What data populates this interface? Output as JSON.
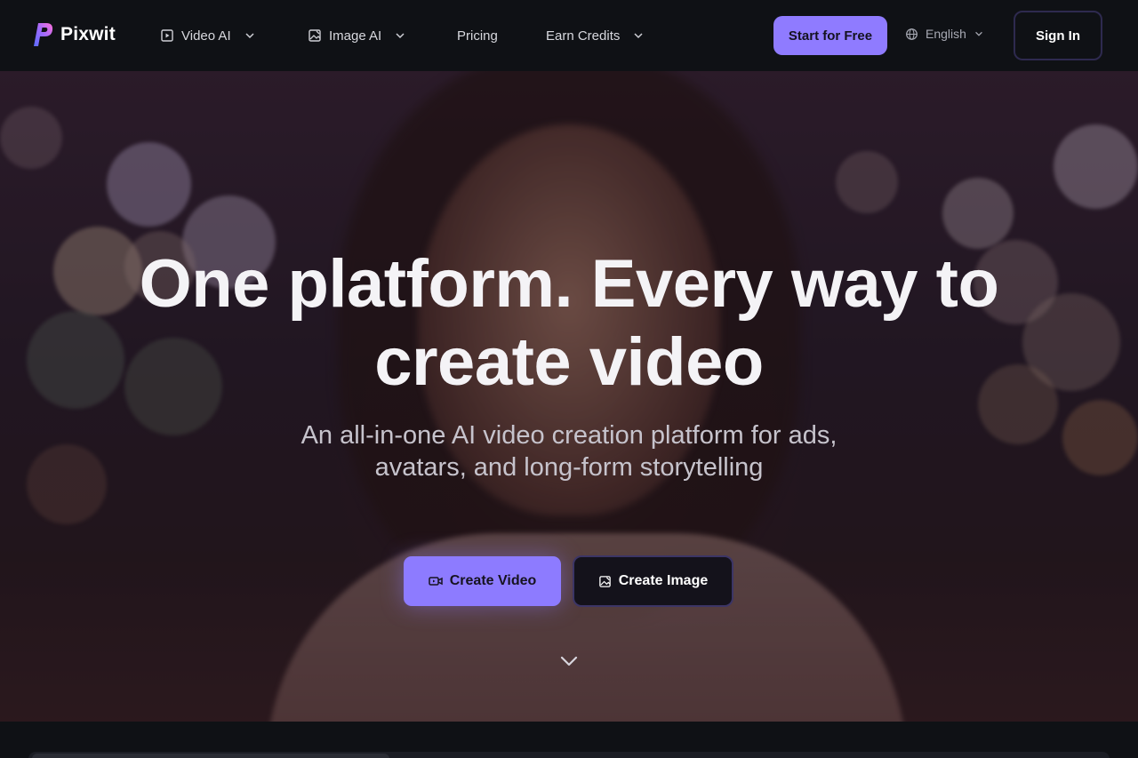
{
  "brand": {
    "name": "Pixwit",
    "logo_icon": "pixwit-logo-icon",
    "accent": "#8f7bff"
  },
  "nav": {
    "items": [
      {
        "label": "Video AI",
        "icon": "video-play-icon",
        "dropdown": true
      },
      {
        "label": "Image AI",
        "icon": "image-edit-icon",
        "dropdown": true
      },
      {
        "label": "Pricing",
        "dropdown": false
      },
      {
        "label": "Earn Credits",
        "dropdown": true
      }
    ],
    "start_label": "Start for Free",
    "language": "English",
    "signin_label": "Sign In"
  },
  "hero": {
    "headline_line1": "One platform. Every way to",
    "headline_line2": "create video",
    "subline_line1": "An all-in-one AI video creation platform for ads,",
    "subline_line2": "avatars, and long-form storytelling",
    "primary_cta": "Create Video",
    "secondary_cta": "Create Image",
    "colors": {
      "primary_button": "#8d7bff",
      "secondary_button": "#14121b"
    }
  }
}
